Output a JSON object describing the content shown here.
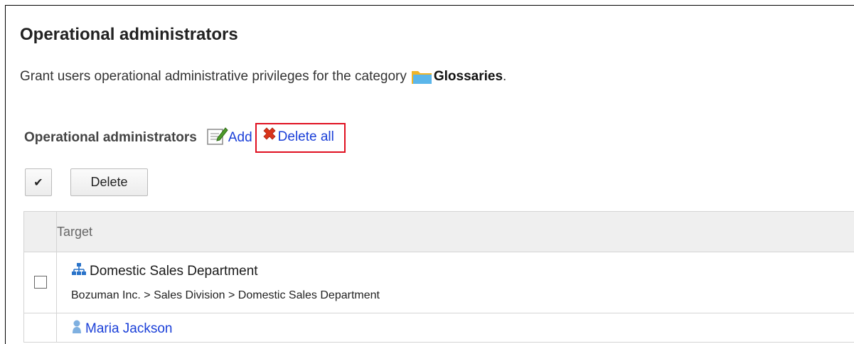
{
  "header": {
    "title": "Operational administrators",
    "description": "Grant users operational administrative privileges for the category",
    "category_name": "Glossaries",
    "description_suffix": "."
  },
  "section": {
    "title": "Operational administrators",
    "add_label": "Add",
    "delete_all_label": "Delete all"
  },
  "toolbar": {
    "check_all_label": "✔",
    "delete_label": "Delete"
  },
  "table": {
    "column_header": "Target",
    "rows": [
      {
        "type": "department",
        "name": "Domestic Sales Department",
        "path": "Bozuman Inc. > Sales Division > Domestic Sales Department"
      },
      {
        "type": "user",
        "name": "Maria Jackson"
      }
    ]
  },
  "colors": {
    "link": "#1a3fd8",
    "highlight_box": "#e01020",
    "header_bg": "#efefef"
  }
}
